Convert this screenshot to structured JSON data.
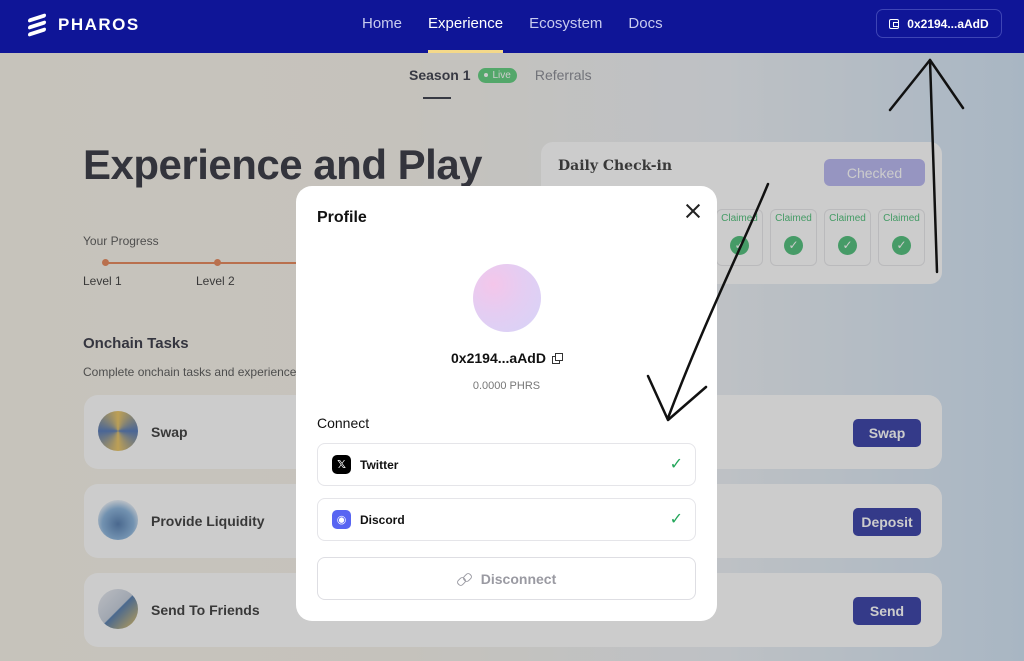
{
  "nav": {
    "brand": "PHAROS",
    "links": [
      {
        "label": "Home",
        "active": false
      },
      {
        "label": "Experience",
        "active": true
      },
      {
        "label": "Ecosystem",
        "active": false
      },
      {
        "label": "Docs",
        "active": false
      }
    ],
    "wallet_label": "0x2194...aAdD"
  },
  "subtabs": {
    "season": "Season 1",
    "live": "Live",
    "referrals": "Referrals"
  },
  "hero": {
    "title": "Experience and Play"
  },
  "progress": {
    "label": "Your Progress",
    "levels": [
      "Level 1",
      "Level 2"
    ]
  },
  "tasks_section": {
    "title": "Onchain Tasks",
    "subtitle": "Complete onchain tasks and experience",
    "items": [
      {
        "label": "Swap",
        "button": "Swap",
        "icon": "swap-icon"
      },
      {
        "label": "Provide Liquidity",
        "button": "Deposit",
        "icon": "liquidity-icon"
      },
      {
        "label": "Send To Friends",
        "button": "Send",
        "icon": "send-icon"
      }
    ]
  },
  "checkin": {
    "title": "Daily Check-in",
    "button": "Checked",
    "days": [
      {
        "label": "Claimed"
      },
      {
        "label": "Claimed"
      },
      {
        "label": "Claimed"
      },
      {
        "label": "Claimed"
      }
    ]
  },
  "modal": {
    "title": "Profile",
    "address": "0x2194...aAdD",
    "balance": "0.0000 PHRS",
    "connect_label": "Connect",
    "socials": [
      {
        "label": "Twitter",
        "icon": "x-icon",
        "connected": true
      },
      {
        "label": "Discord",
        "icon": "discord-icon",
        "connected": true
      }
    ],
    "disconnect": "Disconnect"
  },
  "colors": {
    "nav_bg": "#0f1597",
    "accent_button": "#0b1494",
    "checked_button": "#a8a6ee",
    "success": "#23a65a",
    "progress": "#e06b35"
  }
}
